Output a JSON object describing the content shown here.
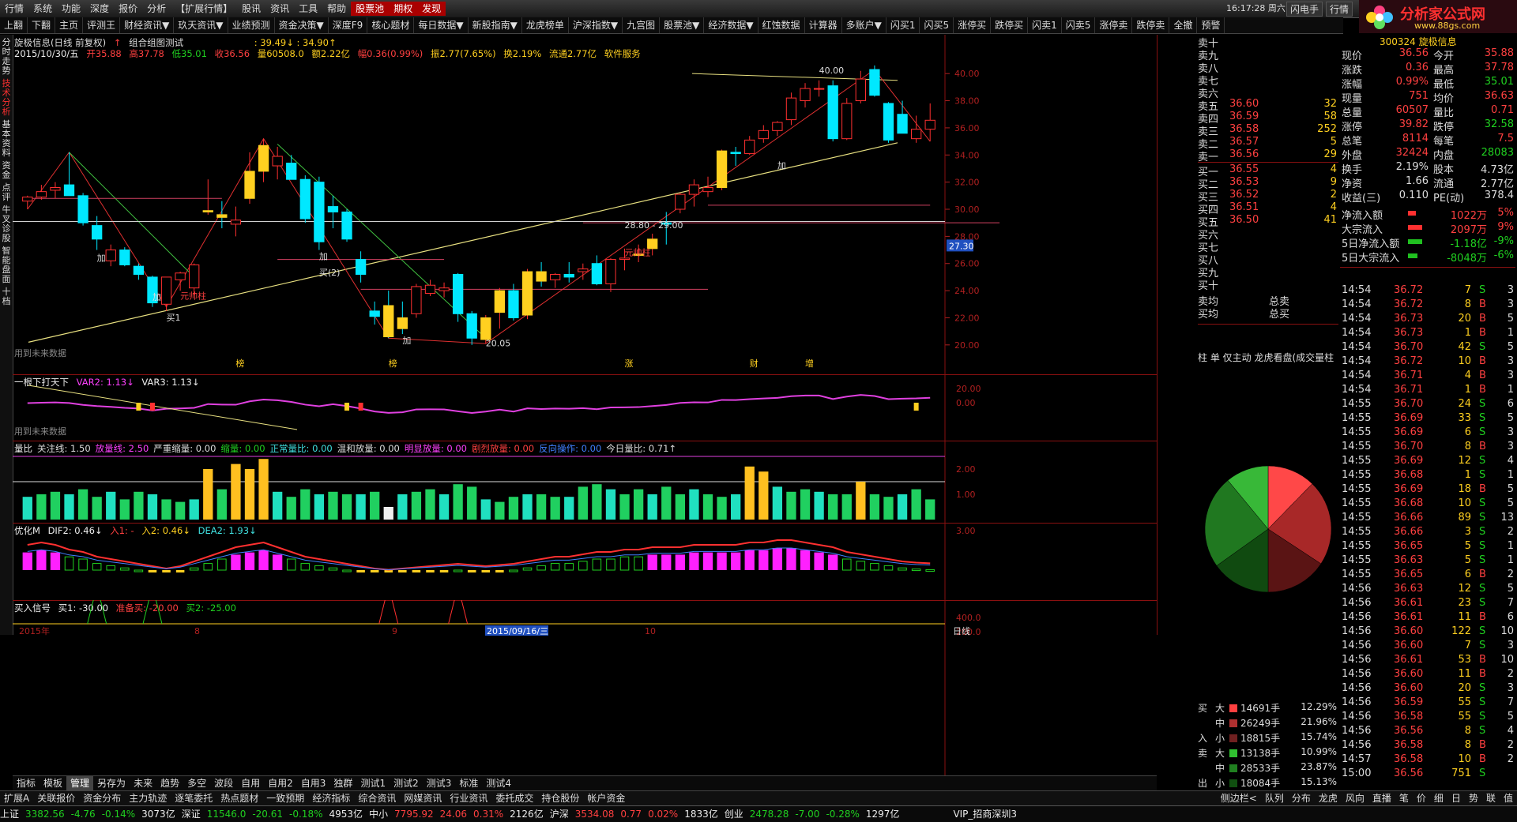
{
  "menu": [
    "行情",
    "系统",
    "功能",
    "深度",
    "报价",
    "分析",
    "【扩展行情】",
    "股讯",
    "资讯",
    "工具",
    "帮助",
    "股票池",
    "期权",
    "发现"
  ],
  "menu_highlight": [
    "股票池",
    "期权",
    "发现"
  ],
  "top_right": {
    "clock": "16:17:28 周六",
    "flash": "闪电手",
    "quote": "行情"
  },
  "brand": {
    "name": "分析家公式网",
    "url": "www.88gs.com",
    "stock_label": "旋极信息"
  },
  "toolbar": [
    "上翻",
    "下翻",
    "主页",
    "评测王",
    "财经资讯▼",
    "玖天资讯▼",
    "业绩预测",
    "资金决策▼",
    "深度F9",
    "核心题材",
    "每日数据▼",
    "新股指南▼",
    "龙虎榜单",
    "沪深指数▼",
    "九宫图",
    "股票池▼",
    "经济数据▼",
    "红蚀数据",
    "计算器",
    "多账户▼",
    "闪买1",
    "闪买5",
    "涨停买",
    "跌停买",
    "闪卖1",
    "闪卖5",
    "涨停卖",
    "跌停卖",
    "全撤",
    "预警"
  ],
  "left_tabs": [
    {
      "label": "分时走势",
      "active": false
    },
    {
      "label": "技术分析",
      "active": true
    },
    {
      "label": "基本资料",
      "active": false
    },
    {
      "label": "资金",
      "active": false
    },
    {
      "label": "点评",
      "active": false
    },
    {
      "label": "牛叉诊股",
      "active": false
    },
    {
      "label": "智能盘面",
      "active": false
    },
    {
      "label": "十档",
      "active": false
    }
  ],
  "main_panel": {
    "title": "旋极信息(日线 前复权)",
    "subtitle": "组合组图测试",
    "range": ": 39.49↓ : 34.90↑",
    "info_date": "2015/10/30/五",
    "info_open": "开35.88",
    "info_high": "高37.78",
    "info_low": "低35.01",
    "info_close": "收36.56",
    "info_vol": "量60508.0",
    "info_amount": "额2.22亿",
    "info_chg": "幅0.36(0.99%)",
    "info_amp": "振2.77(7.65%)",
    "info_turn": "换2.19%",
    "info_float": "流通2.77亿",
    "info_svc": "软件服务",
    "y_ticks": [
      "40.00",
      "38.00",
      "36.00",
      "34.00",
      "32.00",
      "30.00",
      "28.00",
      "26.00",
      "24.00",
      "22.00",
      "20.00"
    ],
    "price_label": "27.30",
    "future_note": "用到未来数据",
    "ann_jia": "加",
    "ann_mai1": "买1",
    "ann_mai2": "买(2)",
    "ann_yuanshuai": "元帅柱",
    "ann_price_low": "20.05",
    "ann_price_high": "40.00",
    "ann_mid": "28.80 - 29.00",
    "month_marks": [
      "榜",
      "榜",
      "涨",
      "财",
      "增"
    ]
  },
  "panel2": {
    "name": "一根下打天下",
    "var2": "VAR2: 1.13↓",
    "var3": "VAR3: 1.13↓",
    "y_ticks": [
      "20.00",
      "0.00"
    ],
    "future_note": "用到未来数据"
  },
  "panel3": {
    "name": "量比",
    "items": [
      "关注线: 1.50",
      "放量线: 2.50",
      "严重缩量: 0.00",
      "缩量: 0.00",
      "正常量比: 0.00",
      "温和放量: 0.00",
      "明显放量: 0.00",
      "剧烈放量: 0.00",
      "反向操作: 0.00",
      "今日量比: 0.71↑"
    ],
    "y_ticks": [
      "2.00",
      "1.00"
    ]
  },
  "panel4": {
    "name": "优化M",
    "dif2": "DIF2: 0.46↓",
    "in1": "入1: -",
    "in2": "入2: 0.46↓",
    "dea2": "DEA2: 1.93↓",
    "y_ticks": [
      "3.00"
    ]
  },
  "panel5": {
    "name": "买入信号",
    "b1": "买1: -30.00",
    "prep": "准备买: -20.00",
    "b2": "买2: -25.00",
    "y_ticks": [
      "400.0",
      "200.0"
    ],
    "labels": [
      "买2",
      "准备买",
      "买2",
      "准备买",
      "准备买",
      "准备买"
    ],
    "x_axis": [
      "2015年",
      "8",
      "9",
      "2015/09/16/三",
      "10",
      "日线"
    ]
  },
  "order_book": {
    "asks": [
      {
        "label": "卖十",
        "price": "",
        "vol": ""
      },
      {
        "label": "卖九",
        "price": "",
        "vol": ""
      },
      {
        "label": "卖八",
        "price": "",
        "vol": ""
      },
      {
        "label": "卖七",
        "price": "",
        "vol": ""
      },
      {
        "label": "卖六",
        "price": "",
        "vol": ""
      },
      {
        "label": "卖五",
        "price": "36.60",
        "vol": "32"
      },
      {
        "label": "卖四",
        "price": "36.59",
        "vol": "58"
      },
      {
        "label": "卖三",
        "price": "36.58",
        "vol": "252"
      },
      {
        "label": "卖二",
        "price": "36.57",
        "vol": "5"
      },
      {
        "label": "卖一",
        "price": "36.56",
        "vol": "29"
      }
    ],
    "bids": [
      {
        "label": "买一",
        "price": "36.55",
        "vol": "4"
      },
      {
        "label": "买二",
        "price": "36.53",
        "vol": "9"
      },
      {
        "label": "买三",
        "price": "36.52",
        "vol": "2"
      },
      {
        "label": "买四",
        "price": "36.51",
        "vol": "4"
      },
      {
        "label": "买五",
        "price": "36.50",
        "vol": "41"
      },
      {
        "label": "买六",
        "price": "",
        "vol": ""
      },
      {
        "label": "买七",
        "price": "",
        "vol": ""
      },
      {
        "label": "买八",
        "price": "",
        "vol": ""
      },
      {
        "label": "买九",
        "price": "",
        "vol": ""
      },
      {
        "label": "买十",
        "price": "",
        "vol": ""
      }
    ],
    "avg_sell": "卖均",
    "avg_buy": "买均",
    "total_sell": "总卖",
    "total_buy": "总买",
    "tabs": "柱 单 仅主动 龙虎看盘(成交量柱"
  },
  "stats": {
    "stock_code": "300324 旋极信息",
    "rows": [
      {
        "k": "现价",
        "v": "36.56",
        "k2": "今开",
        "v2": "35.88"
      },
      {
        "k": "涨跌",
        "v": "0.36",
        "k2": "最高",
        "v2": "37.78"
      },
      {
        "k": "涨幅",
        "v": "0.99%",
        "k2": "最低",
        "v2": "35.01"
      },
      {
        "k": "现量",
        "v": "751",
        "k2": "均价",
        "v2": "36.63"
      },
      {
        "k": "总量",
        "v": "60507",
        "k2": "量比",
        "v2": "0.71"
      },
      {
        "k": "涨停",
        "v": "39.82",
        "k2": "跌停",
        "v2": "32.58"
      },
      {
        "k": "总笔",
        "v": "8114",
        "k2": "每笔",
        "v2": "7.5"
      },
      {
        "k": "外盘",
        "v": "32424",
        "k2": "内盘",
        "v2": "28083"
      },
      {
        "k": "换手",
        "v": "2.19%",
        "k2": "股本",
        "v2": "4.73亿"
      },
      {
        "k": "净资",
        "v": "1.66",
        "k2": "流通",
        "v2": "2.77亿"
      },
      {
        "k": "收益(三)",
        "v": "0.110",
        "k2": "PE(动)",
        "v2": "378.4"
      }
    ],
    "flows": [
      {
        "k": "净流入额",
        "v": "1022万",
        "p": "5%",
        "up": true,
        "bar": 0.05
      },
      {
        "k": "大宗流入",
        "v": "2097万",
        "p": "9%",
        "up": true,
        "bar": 0.09
      },
      {
        "k": "5日净流入额",
        "v": "-1.18亿",
        "p": "-9%",
        "up": false,
        "bar": 0.09
      },
      {
        "k": "5日大宗流入",
        "v": "-8048万",
        "p": "-6%",
        "up": false,
        "bar": 0.06
      }
    ]
  },
  "ticks": [
    {
      "t": "14:54",
      "p": "36.72",
      "q": "7",
      "s": "S",
      "n": "3"
    },
    {
      "t": "14:54",
      "p": "36.72",
      "q": "8",
      "s": "B",
      "n": "3"
    },
    {
      "t": "14:54",
      "p": "36.73",
      "q": "20",
      "s": "B",
      "n": "5"
    },
    {
      "t": "14:54",
      "p": "36.73",
      "q": "1",
      "s": "B",
      "n": "1"
    },
    {
      "t": "14:54",
      "p": "36.70",
      "q": "42",
      "s": "S",
      "n": "5"
    },
    {
      "t": "14:54",
      "p": "36.72",
      "q": "10",
      "s": "B",
      "n": "3"
    },
    {
      "t": "14:54",
      "p": "36.71",
      "q": "4",
      "s": "B",
      "n": "3"
    },
    {
      "t": "14:54",
      "p": "36.71",
      "q": "1",
      "s": "B",
      "n": "1"
    },
    {
      "t": "14:55",
      "p": "36.70",
      "q": "24",
      "s": "S",
      "n": "6"
    },
    {
      "t": "14:55",
      "p": "36.69",
      "q": "33",
      "s": "S",
      "n": "5"
    },
    {
      "t": "14:55",
      "p": "36.69",
      "q": "6",
      "s": "S",
      "n": "3"
    },
    {
      "t": "14:55",
      "p": "36.70",
      "q": "8",
      "s": "B",
      "n": "3"
    },
    {
      "t": "14:55",
      "p": "36.69",
      "q": "12",
      "s": "S",
      "n": "4"
    },
    {
      "t": "14:55",
      "p": "36.68",
      "q": "1",
      "s": "S",
      "n": "1"
    },
    {
      "t": "14:55",
      "p": "36.69",
      "q": "18",
      "s": "B",
      "n": "5"
    },
    {
      "t": "14:55",
      "p": "36.68",
      "q": "10",
      "s": "S",
      "n": "5"
    },
    {
      "t": "14:55",
      "p": "36.66",
      "q": "89",
      "s": "S",
      "n": "13"
    },
    {
      "t": "14:55",
      "p": "36.66",
      "q": "3",
      "s": "S",
      "n": "2"
    },
    {
      "t": "14:55",
      "p": "36.65",
      "q": "5",
      "s": "S",
      "n": "1"
    },
    {
      "t": "14:55",
      "p": "36.63",
      "q": "5",
      "s": "S",
      "n": "1"
    },
    {
      "t": "14:55",
      "p": "36.65",
      "q": "6",
      "s": "B",
      "n": "2"
    },
    {
      "t": "14:56",
      "p": "36.63",
      "q": "12",
      "s": "S",
      "n": "5"
    },
    {
      "t": "14:56",
      "p": "36.61",
      "q": "23",
      "s": "S",
      "n": "7"
    },
    {
      "t": "14:56",
      "p": "36.61",
      "q": "11",
      "s": "B",
      "n": "6"
    },
    {
      "t": "14:56",
      "p": "36.60",
      "q": "122",
      "s": "S",
      "n": "10"
    },
    {
      "t": "14:56",
      "p": "36.60",
      "q": "7",
      "s": "S",
      "n": "3"
    },
    {
      "t": "14:56",
      "p": "36.61",
      "q": "53",
      "s": "B",
      "n": "10"
    },
    {
      "t": "14:56",
      "p": "36.60",
      "q": "11",
      "s": "B",
      "n": "2"
    },
    {
      "t": "14:56",
      "p": "36.60",
      "q": "20",
      "s": "S",
      "n": "3"
    },
    {
      "t": "14:56",
      "p": "36.59",
      "q": "55",
      "s": "S",
      "n": "7"
    },
    {
      "t": "14:56",
      "p": "36.58",
      "q": "55",
      "s": "S",
      "n": "5"
    },
    {
      "t": "14:56",
      "p": "36.56",
      "q": "8",
      "s": "S",
      "n": "4"
    },
    {
      "t": "14:56",
      "p": "36.58",
      "q": "8",
      "s": "B",
      "n": "2"
    },
    {
      "t": "14:57",
      "p": "36.58",
      "q": "10",
      "s": "B",
      "n": "2"
    },
    {
      "t": "15:00",
      "p": "36.56",
      "q": "751",
      "s": "S",
      "n": ""
    }
  ],
  "money_flow": [
    {
      "side": "买",
      "size": "大",
      "vol": "14691手",
      "pct": "12.29%",
      "color": "#ff4040"
    },
    {
      "side": "",
      "size": "中",
      "vol": "26249手",
      "pct": "21.96%",
      "color": "#b03030"
    },
    {
      "side": "入",
      "size": "小",
      "vol": "18815手",
      "pct": "15.74%",
      "color": "#702020"
    },
    {
      "side": "卖",
      "size": "大",
      "vol": "13138手",
      "pct": "10.99%",
      "color": "#30c030"
    },
    {
      "side": "",
      "size": "中",
      "vol": "28533手",
      "pct": "23.87%",
      "color": "#208020"
    },
    {
      "side": "出",
      "size": "小",
      "vol": "18084手",
      "pct": "15.13%",
      "color": "#105010"
    }
  ],
  "bottom_tabs": [
    "指标",
    "模板",
    "管理",
    "另存为",
    "未来",
    "趋势",
    "多空",
    "波段",
    "自用",
    "自用2",
    "自用3",
    "独群",
    "测试1",
    "测试2",
    "测试3",
    "标准",
    "测试4"
  ],
  "bottom_tabs_active": "管理",
  "bottom_bar2": [
    "扩展A",
    "关联报价",
    "资金分布",
    "主力轨迹",
    "逐笔委托",
    "热点题材",
    "一致预期",
    "经济指标",
    "综合资讯",
    "网媒资讯",
    "行业资讯",
    "委托成交",
    "持仓股份",
    "帐户资金"
  ],
  "bottom_bar2_right": [
    "侧边栏<",
    "队列",
    "分布",
    "龙虎",
    "风向",
    "直播"
  ],
  "bottom_bar2_right2": [
    "笔",
    "价",
    "细",
    "日",
    "势",
    "联",
    "值"
  ],
  "status": [
    {
      "label": "上证",
      "val": "3382.56",
      "chg": "-4.76",
      "pct": "-0.14%",
      "amt": "3073亿"
    },
    {
      "label": "深证",
      "val": "11546.0",
      "chg": "-20.61",
      "pct": "-0.18%",
      "amt": "4953亿"
    },
    {
      "label": "中小",
      "val": "7795.92",
      "chg": "24.06",
      "pct": "0.31%",
      "amt": "2126亿"
    },
    {
      "label": "沪深",
      "val": "3534.08",
      "chg": "0.77",
      "pct": "0.02%",
      "amt": "1833亿"
    },
    {
      "label": "创业",
      "val": "2478.28",
      "chg": "-7.00",
      "pct": "-0.28%",
      "amt": "1297亿"
    }
  ],
  "status_vip": "VIP_招商深圳3",
  "chart_data": {
    "type": "candlestick",
    "note": "daily K-line, 2015 Aug-Oct",
    "ylim": [
      19,
      41
    ],
    "candles": [
      [
        30.6,
        31.0,
        30.0,
        30.9
      ],
      [
        30.9,
        31.8,
        30.7,
        31.3
      ],
      [
        31.4,
        32.0,
        30.8,
        31.6
      ],
      [
        31.8,
        34.2,
        31.2,
        31.0
      ],
      [
        31.0,
        31.2,
        28.8,
        29.0
      ],
      [
        28.8,
        29.5,
        27.0,
        27.8
      ],
      [
        26.2,
        27.4,
        25.8,
        27.0
      ],
      [
        27.0,
        27.2,
        25.8,
        25.9
      ],
      [
        25.8,
        26.0,
        24.8,
        25.2
      ],
      [
        25.0,
        25.1,
        22.8,
        23.1
      ],
      [
        23.0,
        25.0,
        22.5,
        25.0
      ],
      [
        24.8,
        25.4,
        24.0,
        25.3
      ],
      [
        24.2,
        26.0,
        23.7,
        25.9
      ],
      [
        29.8,
        32.2,
        29.6,
        29.9
      ],
      [
        29.6,
        30.6,
        28.6,
        29.4
      ],
      [
        28.9,
        30.2,
        28.0,
        29.2
      ],
      [
        30.8,
        34.2,
        30.4,
        32.8
      ],
      [
        32.8,
        35.2,
        32.0,
        34.7
      ],
      [
        33.2,
        34.6,
        32.2,
        33.9
      ],
      [
        33.4,
        34.0,
        32.2,
        32.2
      ],
      [
        32.2,
        32.5,
        29.0,
        29.3
      ],
      [
        32.0,
        32.4,
        27.0,
        27.6
      ],
      [
        30.2,
        31.0,
        28.6,
        29.8
      ],
      [
        29.8,
        30.0,
        27.6,
        27.8
      ],
      [
        26.3,
        26.9,
        24.6,
        25.2
      ],
      [
        22.5,
        23.2,
        21.5,
        22.1
      ],
      [
        22.9,
        24.0,
        20.5,
        20.6
      ],
      [
        22.0,
        23.2,
        20.8,
        21.2
      ],
      [
        22.3,
        24.5,
        22.0,
        24.3
      ],
      [
        23.8,
        24.8,
        23.6,
        24.4
      ],
      [
        24.0,
        24.6,
        23.5,
        24.2
      ],
      [
        25.2,
        25.3,
        21.7,
        22.3
      ],
      [
        22.3,
        22.5,
        20.0,
        20.5
      ],
      [
        20.4,
        22.2,
        20.1,
        22.0
      ],
      [
        22.4,
        24.2,
        21.2,
        24.0
      ],
      [
        24.0,
        24.5,
        21.8,
        22.0
      ],
      [
        22.2,
        25.6,
        21.9,
        25.4
      ],
      [
        25.4,
        26.1,
        24.3,
        24.7
      ],
      [
        24.8,
        25.3,
        24.2,
        25.2
      ],
      [
        25.2,
        26.1,
        24.6,
        25.0
      ],
      [
        25.4,
        26.0,
        24.8,
        25.6
      ],
      [
        26.0,
        26.6,
        24.4,
        24.5
      ],
      [
        24.5,
        26.4,
        23.9,
        26.3
      ],
      [
        26.3,
        27.1,
        25.5,
        26.4
      ],
      [
        26.6,
        27.4,
        26.1,
        26.7
      ],
      [
        27.1,
        28.2,
        26.6,
        27.8
      ],
      [
        29.0,
        29.8,
        27.4,
        28.9
      ],
      [
        30.0,
        31.2,
        29.7,
        31.1
      ],
      [
        31.1,
        32.2,
        30.2,
        31.8
      ],
      [
        31.3,
        32.4,
        30.9,
        31.6
      ],
      [
        31.6,
        34.4,
        31.4,
        34.3
      ],
      [
        34.2,
        34.6,
        33.2,
        34.1
      ],
      [
        34.1,
        35.4,
        34.0,
        35.1
      ],
      [
        35.2,
        36.2,
        34.9,
        35.8
      ],
      [
        35.8,
        36.5,
        35.4,
        36.4
      ],
      [
        36.6,
        38.6,
        36.2,
        38.2
      ],
      [
        38.0,
        39.3,
        37.5,
        38.9
      ],
      [
        38.9,
        39.5,
        38.3,
        38.9
      ],
      [
        39.1,
        39.5,
        35.0,
        35.2
      ],
      [
        35.2,
        38.2,
        35.1,
        37.8
      ],
      [
        38.0,
        40.2,
        37.8,
        39.6
      ],
      [
        40.3,
        40.6,
        38.3,
        38.4
      ],
      [
        37.8,
        37.9,
        34.9,
        35.1
      ],
      [
        37.0,
        38.0,
        35.6,
        35.6
      ],
      [
        35.2,
        36.9,
        34.9,
        35.9
      ],
      [
        35.9,
        37.8,
        35.0,
        36.56
      ]
    ],
    "volume_ratio": [
      0.9,
      1.0,
      1.1,
      1.0,
      1.2,
      0.9,
      1.1,
      0.8,
      1.1,
      1.0,
      0.8,
      0.7,
      0.8,
      2.0,
      1.2,
      2.2,
      2.0,
      2.4,
      1.1,
      0.9,
      1.2,
      1.0,
      1.1,
      1.0,
      1.0,
      1.1,
      0.5,
      1.0,
      1.1,
      1.2,
      1.0,
      1.4,
      1.3,
      0.8,
      0.7,
      0.9,
      1.0,
      1.0,
      0.9,
      0.9,
      1.3,
      1.4,
      1.2,
      1.0,
      1.2,
      1.0,
      1.3,
      1.0,
      1.2,
      1.0,
      0.9,
      1.0,
      2.1,
      1.9,
      1.3,
      1.1,
      1.2,
      1.1,
      1.0,
      1.0,
      1.5,
      1.0,
      0.9,
      1.0,
      1.2,
      0.8,
      0.9,
      0.8,
      0.71
    ],
    "macd_hist": [
      0.8,
      0.9,
      0.8,
      0.6,
      0.5,
      0.3,
      0.2,
      0.1,
      0.0,
      -0.1,
      -0.2,
      -0.1,
      0.1,
      0.3,
      0.5,
      0.7,
      0.8,
      0.9,
      0.7,
      0.5,
      0.3,
      0.2,
      0.1,
      0.0,
      -0.1,
      -0.2,
      -0.25,
      -0.2,
      -0.15,
      -0.1,
      -0.05,
      0.0,
      -0.05,
      -0.1,
      -0.05,
      0.0,
      0.1,
      0.2,
      0.3,
      0.3,
      0.4,
      0.5,
      0.5,
      0.6,
      0.6,
      0.7,
      0.7,
      0.7,
      0.8,
      0.8,
      0.8,
      0.8,
      0.9,
      0.9,
      1.0,
      1.0,
      0.9,
      0.8,
      0.7,
      0.5,
      0.4,
      0.3,
      0.2,
      0.1,
      0.05,
      0.02
    ],
    "pie": [
      {
        "name": "买大",
        "value": 12.29
      },
      {
        "name": "买中",
        "value": 21.96
      },
      {
        "name": "买小",
        "value": 15.74
      },
      {
        "name": "卖小",
        "value": 15.13
      },
      {
        "name": "卖中",
        "value": 23.87
      },
      {
        "name": "卖大",
        "value": 10.99
      }
    ]
  }
}
